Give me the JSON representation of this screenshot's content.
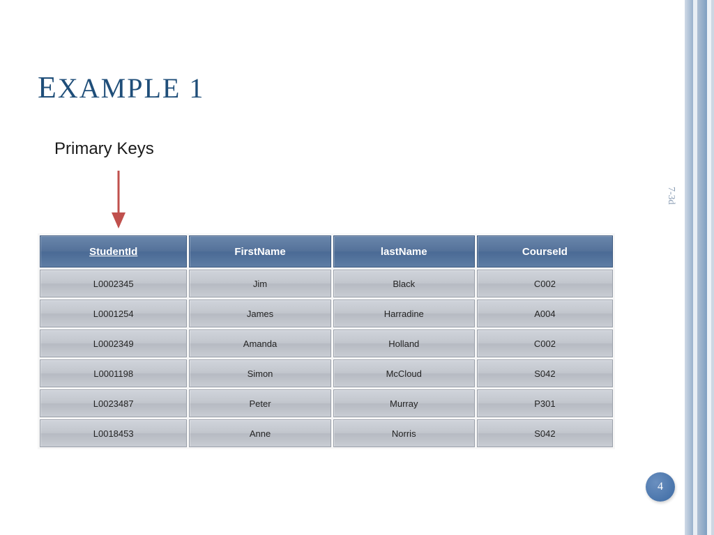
{
  "title": "EXAMPLE 1",
  "label_primary_keys": "Primary Keys",
  "side_text": "7-3d",
  "page_number": "4",
  "table": {
    "columns": [
      {
        "name": "StudentId",
        "is_primary_key": true
      },
      {
        "name": "FirstName",
        "is_primary_key": false
      },
      {
        "name": "lastName",
        "is_primary_key": false
      },
      {
        "name": "CourseId",
        "is_primary_key": false
      }
    ],
    "rows": [
      {
        "student_id": "L0002345",
        "first_name": "Jim",
        "last_name": "Black",
        "course_id": "C002"
      },
      {
        "student_id": "L0001254",
        "first_name": "James",
        "last_name": "Harradine",
        "course_id": "A004"
      },
      {
        "student_id": "L0002349",
        "first_name": "Amanda",
        "last_name": "Holland",
        "course_id": "C002"
      },
      {
        "student_id": "L0001198",
        "first_name": "Simon",
        "last_name": "McCloud",
        "course_id": "S042"
      },
      {
        "student_id": "L0023487",
        "first_name": "Peter",
        "last_name": "Murray",
        "course_id": "P301"
      },
      {
        "student_id": "L0018453",
        "first_name": "Anne",
        "last_name": "Norris",
        "course_id": "S042"
      }
    ]
  },
  "colors": {
    "title": "#1f4e79",
    "header_bg": "#55729a",
    "cell_bg": "#c2c6cd",
    "arrow": "#c0504d",
    "badge": "#3c6aa3"
  }
}
